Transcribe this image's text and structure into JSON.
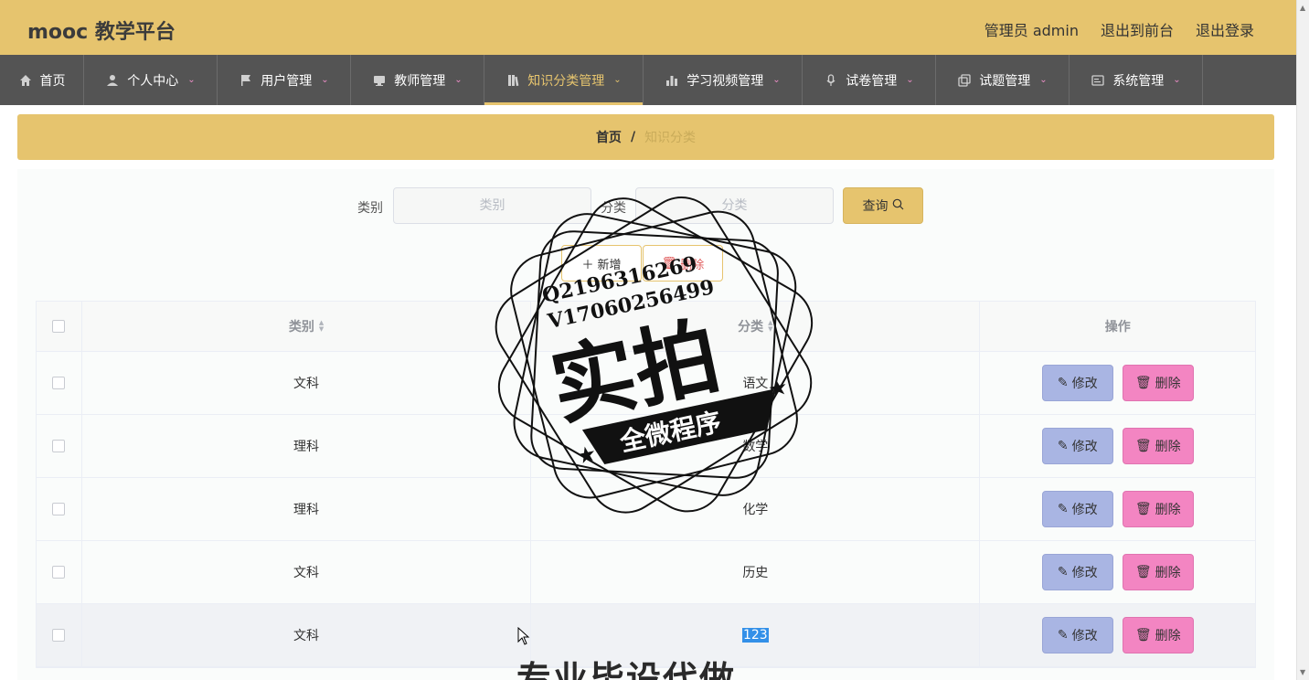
{
  "header": {
    "title": "mooc 教学平台",
    "links": [
      "管理员 admin",
      "退出到前台",
      "退出登录"
    ]
  },
  "nav": {
    "items": [
      {
        "label": "首页",
        "icon": "home-icon"
      },
      {
        "label": "个人中心",
        "icon": "user-icon"
      },
      {
        "label": "用户管理",
        "icon": "flag-icon"
      },
      {
        "label": "教师管理",
        "icon": "monitor-icon"
      },
      {
        "label": "知识分类管理",
        "icon": "book-icon"
      },
      {
        "label": "学习视频管理",
        "icon": "bar-chart-icon"
      },
      {
        "label": "试卷管理",
        "icon": "microphone-icon"
      },
      {
        "label": "试题管理",
        "icon": "copy-icon"
      },
      {
        "label": "系统管理",
        "icon": "card-icon"
      }
    ],
    "active": "知识分类管理"
  },
  "breadcrumb": {
    "home": "首页",
    "separator": "/",
    "current": "知识分类"
  },
  "search": {
    "category_label": "类别",
    "category_placeholder": "类别",
    "classify_label": "分类",
    "classify_placeholder": "分类",
    "query_button": "查询"
  },
  "actions": {
    "add": "新增",
    "batch_delete": "删除"
  },
  "table": {
    "headers": [
      "类别",
      "分类",
      "操作"
    ],
    "rows": [
      {
        "category": "文科",
        "classify": "语文"
      },
      {
        "category": "理科",
        "classify": "数学"
      },
      {
        "category": "理科",
        "classify": "化学"
      },
      {
        "category": "文科",
        "classify": "历史"
      },
      {
        "category": "文科",
        "classify": "123"
      }
    ],
    "edit_label": "修改",
    "delete_label": "删除"
  },
  "overlay": {
    "line1": "Q2196316269",
    "line2": "V17060256499",
    "big": "实拍",
    "banner": "全微程序",
    "bottom": "专业毕设代做"
  },
  "colors": {
    "accent": "#e6c46e",
    "nav_bg": "#545454",
    "edit_btn": "#a9b5e3",
    "delete_btn": "#f385c2"
  }
}
